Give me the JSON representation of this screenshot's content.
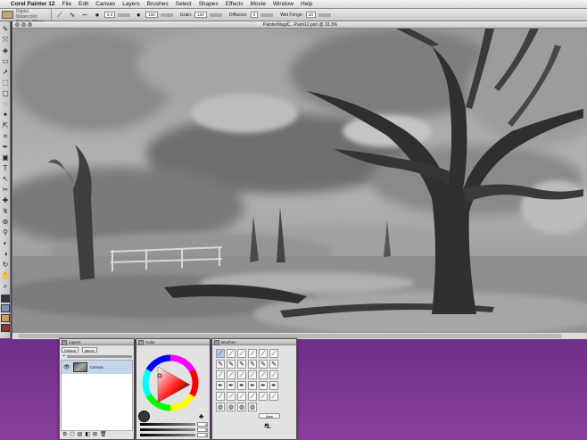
{
  "menubar": {
    "apple_icon": "apple-icon",
    "app_name": "Corel Painter 12",
    "items": [
      "File",
      "Edit",
      "Canvas",
      "Layers",
      "Brushes",
      "Select",
      "Shapes",
      "Effects",
      "Movie",
      "Window",
      "Help"
    ]
  },
  "propbar": {
    "brush_category": "Digital Watercolor",
    "brush_variant": "Simple Water",
    "size_value": "6.0",
    "opacity_value": "100",
    "grain_label": "Grain:",
    "grain_value": "100",
    "diffusion_label": "Diffusion:",
    "diffusion_value": "0",
    "wet_fringe_label": "Wet Fringe:",
    "wet_fringe_value": "20"
  },
  "document": {
    "title": "PainterMagIC...Paint12.psd @ 33.3%"
  },
  "layers_panel": {
    "title": "Layers",
    "composite_method": "Default",
    "composite_depth": "Ignore",
    "layer_name": "Canvas"
  },
  "color_panel": {
    "title": "Color",
    "slider_values": [
      "0",
      "0",
      "0"
    ]
  },
  "brushes_panel": {
    "title": "Brushes",
    "new_button": "New"
  },
  "colors": {
    "desktop_top": "#0c1640",
    "desktop_bottom": "#8a3f9a",
    "layer_selected": "#c3d6ec"
  }
}
